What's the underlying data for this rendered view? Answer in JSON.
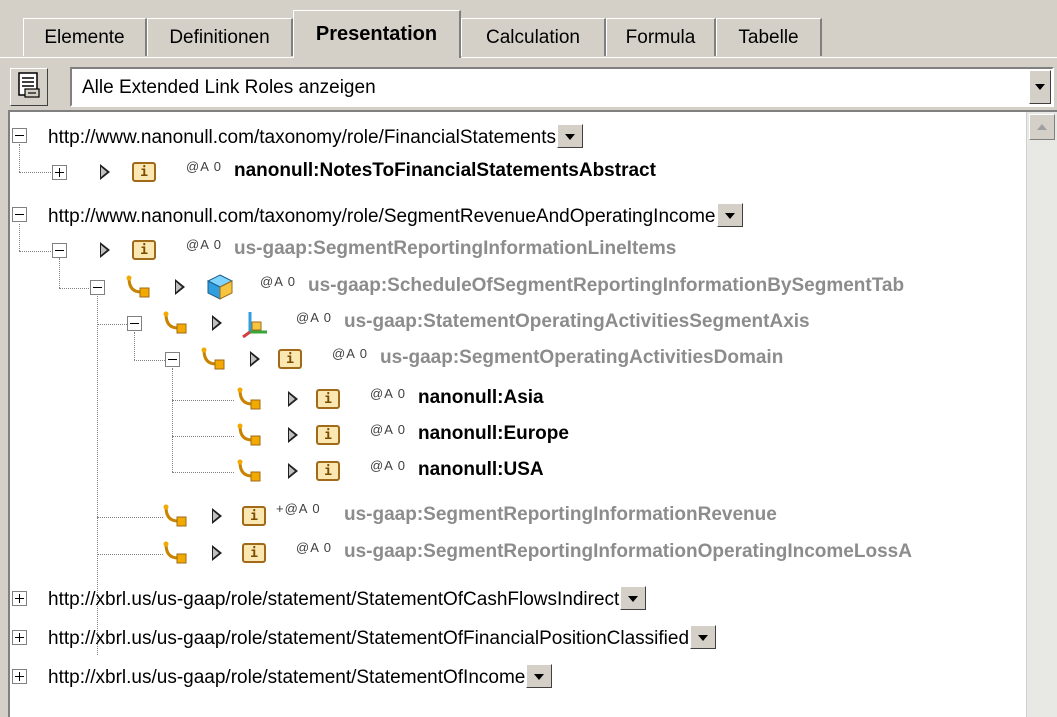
{
  "tabs": [
    {
      "label": "Elemente"
    },
    {
      "label": "Definitionen"
    },
    {
      "label": "Presentation"
    },
    {
      "label": "Calculation"
    },
    {
      "label": "Formula"
    },
    {
      "label": "Tabelle"
    }
  ],
  "active_tab": "Presentation",
  "toolbar": {
    "icon": "link-roles-icon",
    "combo_value": "Alle Extended Link Roles anzeigen"
  },
  "tree": {
    "roles": [
      {
        "uri": "http://www.nanonull.com/taxonomy/role/FinancialStatements",
        "expanded": true
      },
      {
        "uri": "http://www.nanonull.com/taxonomy/role/SegmentRevenueAndOperatingIncome",
        "expanded": true
      },
      {
        "uri": "http://xbrl.us/us-gaap/role/statement/StatementOfCashFlowsIndirect",
        "expanded": false
      },
      {
        "uri": "http://xbrl.us/us-gaap/role/statement/StatementOfFinancialPositionClassified",
        "expanded": false
      },
      {
        "uri": "http://xbrl.us/us-gaap/role/statement/StatementOfIncome",
        "expanded": false
      }
    ],
    "nodes": [
      {
        "name": "nanonull:NotesToFinancialStatementsAbstract",
        "attr": "@A 0",
        "icon": "item-icon",
        "style": "black"
      },
      {
        "name": "us-gaap:SegmentReportingInformationLineItems",
        "attr": "@A 0",
        "icon": "item-icon",
        "style": "gray"
      },
      {
        "name": "us-gaap:ScheduleOfSegmentReportingInformationBySegmentTab",
        "attr": "@A 0",
        "icon": "hypercube-icon",
        "style": "gray"
      },
      {
        "name": "us-gaap:StatementOperatingActivitiesSegmentAxis",
        "attr": "@A 0",
        "icon": "dimension-icon",
        "style": "gray"
      },
      {
        "name": "us-gaap:SegmentOperatingActivitiesDomain",
        "attr": "@A 0",
        "icon": "item-icon",
        "style": "gray"
      },
      {
        "name": "nanonull:Asia",
        "attr": "@A 0",
        "icon": "item-icon",
        "style": "black"
      },
      {
        "name": "nanonull:Europe",
        "attr": "@A 0",
        "icon": "item-icon",
        "style": "black"
      },
      {
        "name": "nanonull:USA",
        "attr": "@A 0",
        "icon": "item-icon",
        "style": "black"
      },
      {
        "name": "us-gaap:SegmentReportingInformationRevenue",
        "attr": "+@A 0",
        "icon": "item-icon",
        "style": "gray"
      },
      {
        "name": "us-gaap:SegmentReportingInformationOperatingIncomeLossA",
        "attr": "@A 0",
        "icon": "item-icon",
        "style": "gray"
      }
    ]
  },
  "item_icon_glyph": "i",
  "colors": {
    "item_fill": "#fbe7b1",
    "item_border": "#a06a18",
    "gray_text": "#8c8c8c"
  }
}
